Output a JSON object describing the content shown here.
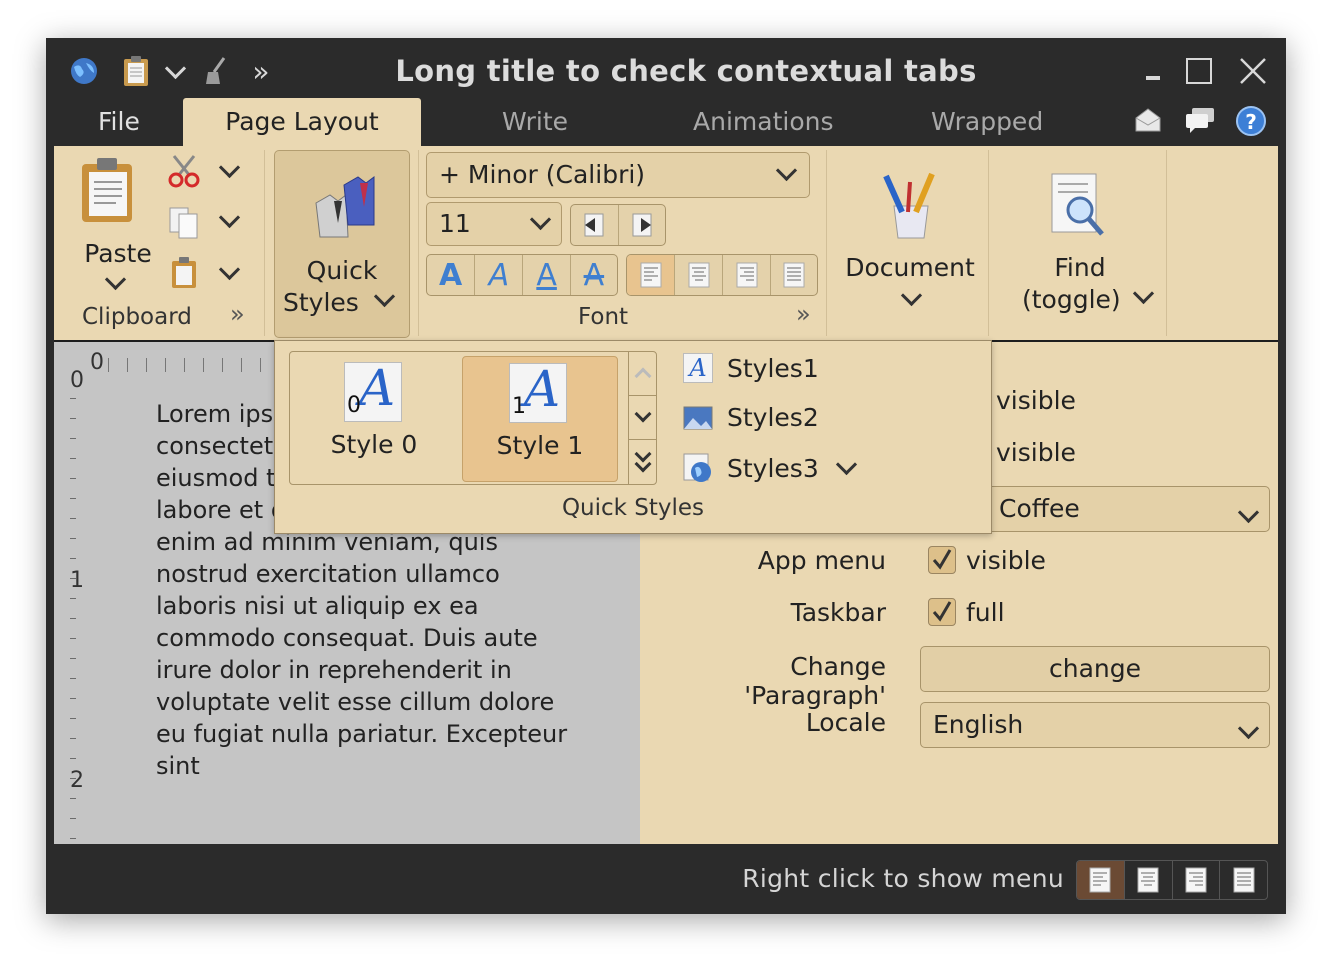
{
  "window": {
    "title": "Long title to check contextual tabs"
  },
  "quick_access": {
    "icons": [
      "globe-icon",
      "clipboard-icon",
      "dropdown-chevron-icon",
      "broom-icon",
      "overflow-icon"
    ]
  },
  "tabs": {
    "file": "File",
    "page_layout": "Page Layout",
    "write": "Write",
    "animations": "Animations",
    "wrapped": "Wrapped"
  },
  "ribbon": {
    "clipboard": {
      "group_label": "Clipboard",
      "paste_label": "Paste"
    },
    "quick_styles": {
      "label_line1": "Quick",
      "label_line2": "Styles"
    },
    "font": {
      "group_label": "Font",
      "family": "+ Minor (Calibri)",
      "size": "11"
    },
    "document": {
      "label": "Document"
    },
    "find": {
      "label_line1": "Find",
      "label_line2": "(toggle)"
    }
  },
  "popup": {
    "group_label": "Quick Styles",
    "gallery": [
      {
        "label": "Style 0",
        "index": "0",
        "selected": false
      },
      {
        "label": "Style 1",
        "index": "1",
        "selected": true
      }
    ],
    "menu": [
      "Styles1",
      "Styles2",
      "Styles3"
    ]
  },
  "document": {
    "text": "Lorem ipsum dolor sit amet, consectetur adipiscing elit, sed do eiusmod tempor incididunt ut labore et dolore magna aliqua. Ut enim ad minim veniam, quis nostrud exercitation ullamco laboris nisi ut aliquip ex ea commodo consequat. Duis aute irure dolor in reprehenderit in voluptate velit esse cillum dolore eu fugiat nulla pariatur. Excepteur sint",
    "ruler_numbers": {
      "h0": "0",
      "v0": "0",
      "v1": "1",
      "v2": "2"
    }
  },
  "settings": {
    "row1_value": "visible",
    "row2_value": "visible",
    "theme_value": "Coffee",
    "app_menu": {
      "label": "App menu",
      "value": "visible",
      "checked": true
    },
    "taskbar": {
      "label": "Taskbar",
      "value": "full",
      "checked": true
    },
    "change_paragraph": {
      "label": "Change 'Paragraph'",
      "button": "change"
    },
    "locale": {
      "label": "Locale",
      "value": "English"
    }
  },
  "status": {
    "text": "Right click to show menu"
  },
  "colors": {
    "ribbon_bg": "#ead8b2",
    "dark_chrome": "#2b2b2b",
    "selected_fill": "#e8c48f"
  }
}
